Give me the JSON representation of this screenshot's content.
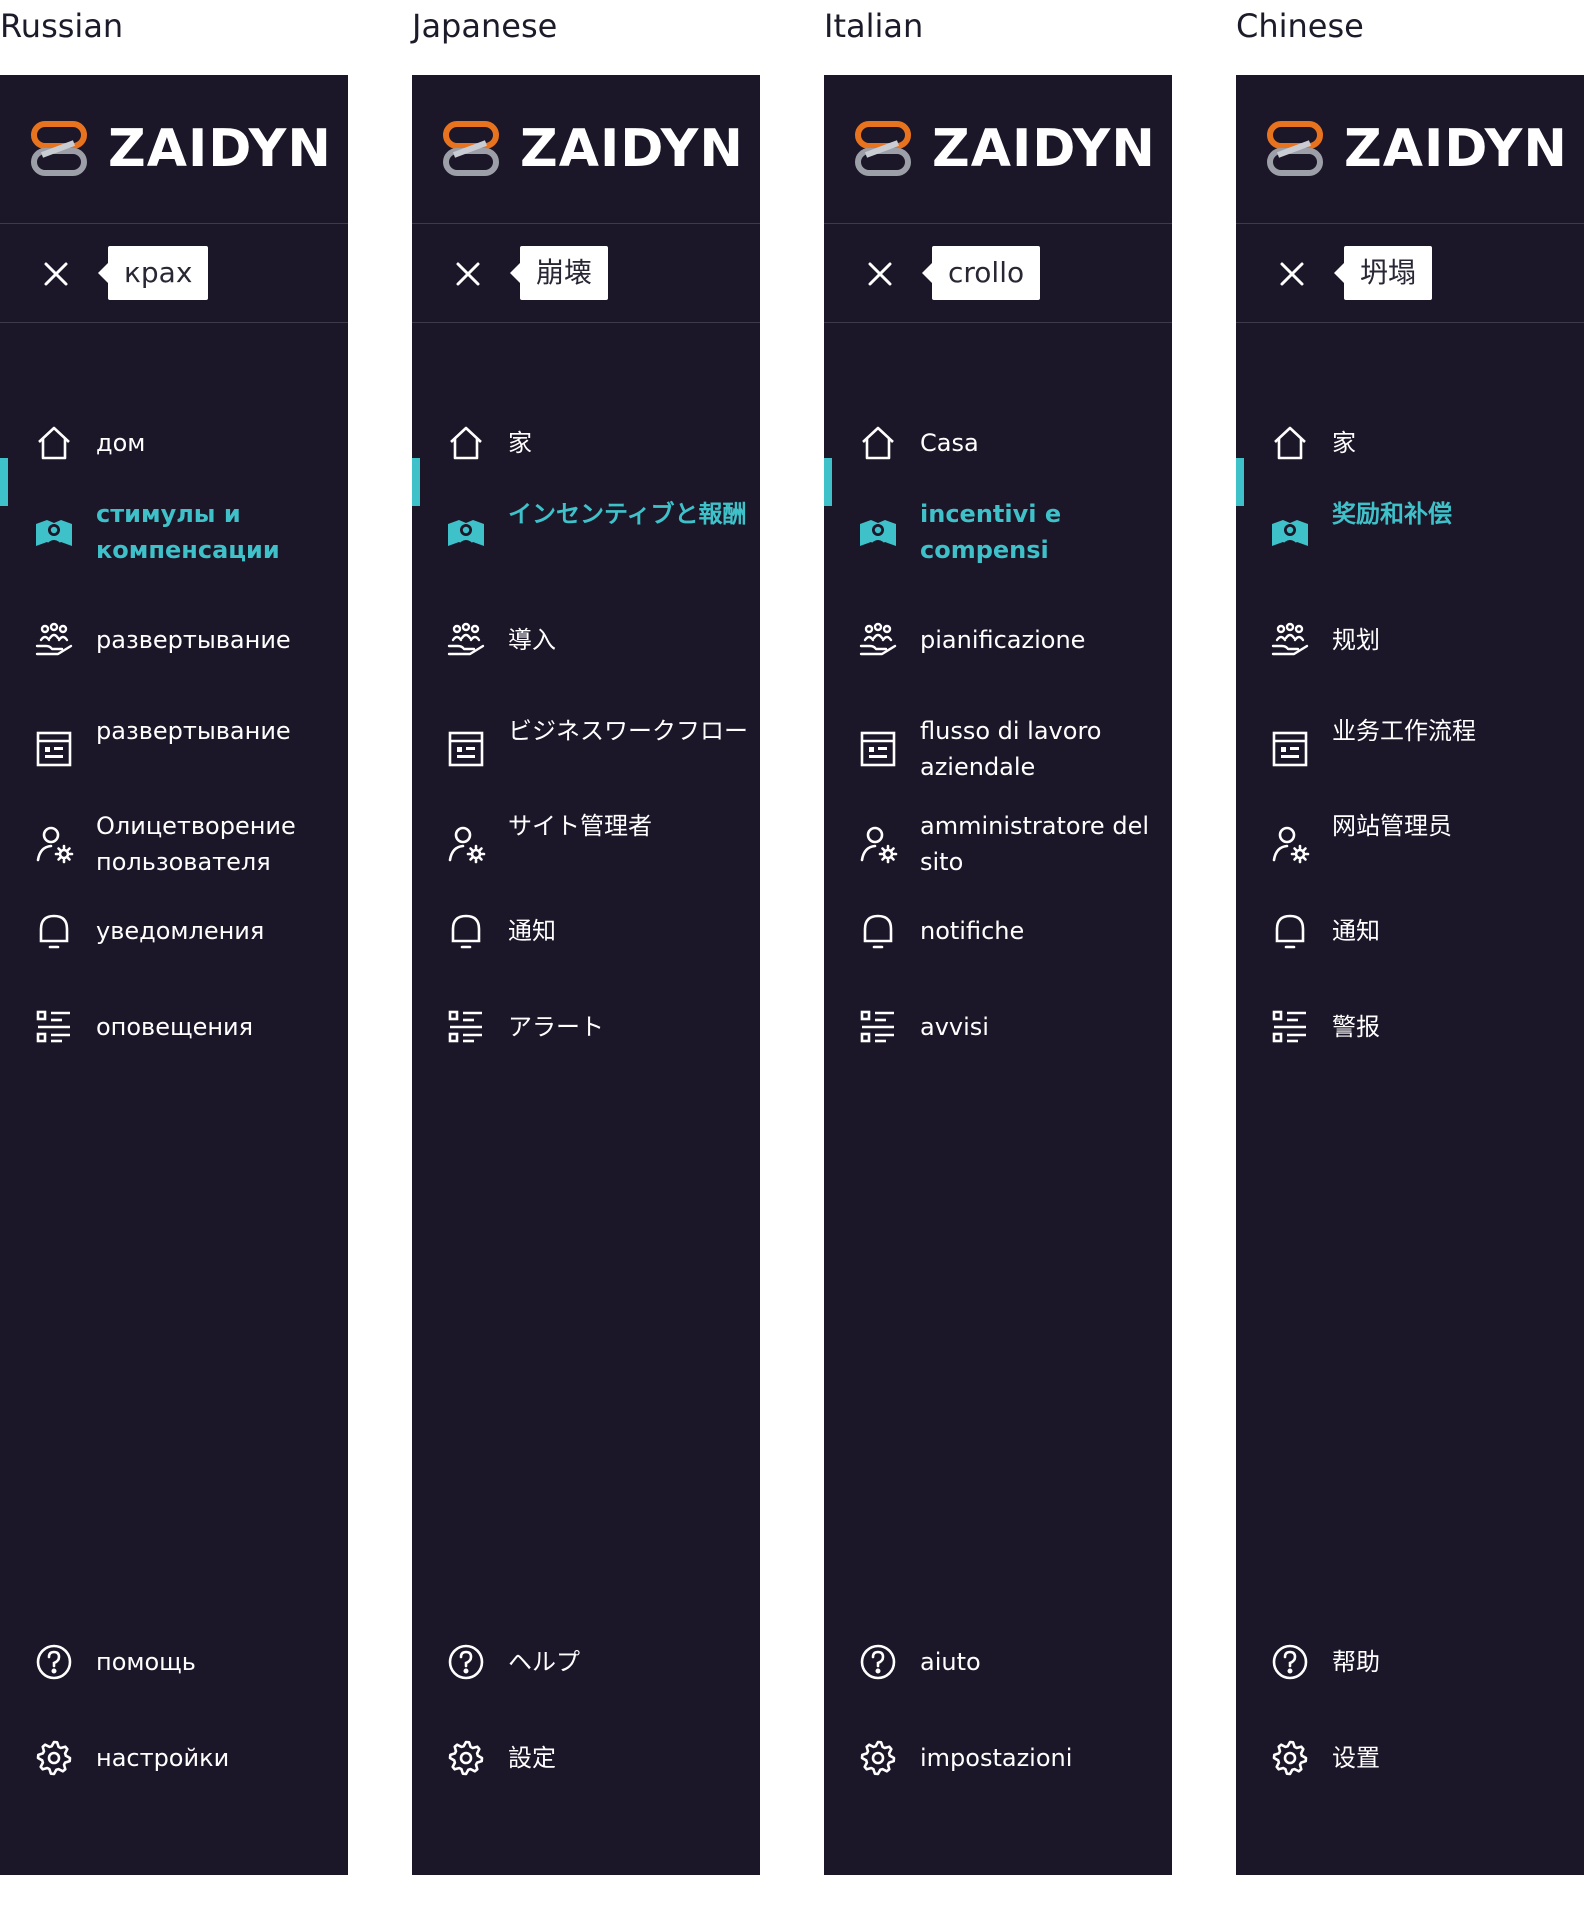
{
  "brand": {
    "name": "ZAIDYN",
    "icon": "zaidyn-logo",
    "colors": {
      "accent": "#3fc1c9",
      "orange": "#e8731f",
      "panel": "#1b1628",
      "divider": "#3e3a4c"
    }
  },
  "columns": [
    {
      "language": "Russian",
      "tooltip": "крах",
      "nav": [
        {
          "icon": "home-icon",
          "label": "дом",
          "active": false
        },
        {
          "icon": "incentive-icon",
          "label": "стимулы и компенсации",
          "active": true
        },
        {
          "icon": "hand-people-icon",
          "label": "развертывание",
          "active": false
        },
        {
          "icon": "workflow-icon",
          "label": "развертывание",
          "active": false
        },
        {
          "icon": "user-gear-icon",
          "label": "Олицетворение пользователя",
          "active": false
        },
        {
          "icon": "bell-icon",
          "label": "уведомления",
          "active": false
        },
        {
          "icon": "list-icon",
          "label": "оповещения",
          "active": false
        }
      ],
      "bottom": [
        {
          "icon": "help-icon",
          "label": "помощь"
        },
        {
          "icon": "settings-icon",
          "label": "настройки"
        }
      ]
    },
    {
      "language": "Japanese",
      "tooltip": "崩壊",
      "nav": [
        {
          "icon": "home-icon",
          "label": "家",
          "active": false
        },
        {
          "icon": "incentive-icon",
          "label": "インセンティブと報酬",
          "active": true
        },
        {
          "icon": "hand-people-icon",
          "label": "導入",
          "active": false
        },
        {
          "icon": "workflow-icon",
          "label": "ビジネスワークフロー",
          "active": false
        },
        {
          "icon": "user-gear-icon",
          "label": "サイト管理者",
          "active": false
        },
        {
          "icon": "bell-icon",
          "label": "通知",
          "active": false
        },
        {
          "icon": "list-icon",
          "label": "アラート",
          "active": false
        }
      ],
      "bottom": [
        {
          "icon": "help-icon",
          "label": "ヘルプ"
        },
        {
          "icon": "settings-icon",
          "label": "設定"
        }
      ]
    },
    {
      "language": "Italian",
      "tooltip": "crollo",
      "nav": [
        {
          "icon": "home-icon",
          "label": "Casa",
          "active": false
        },
        {
          "icon": "incentive-icon",
          "label": "incentivi e compensi",
          "active": true
        },
        {
          "icon": "hand-people-icon",
          "label": "pianificazione",
          "active": false
        },
        {
          "icon": "workflow-icon",
          "label": "flusso di lavoro aziendale",
          "active": false
        },
        {
          "icon": "user-gear-icon",
          "label": "amministratore del sito",
          "active": false
        },
        {
          "icon": "bell-icon",
          "label": "notifiche",
          "active": false
        },
        {
          "icon": "list-icon",
          "label": "avvisi",
          "active": false
        }
      ],
      "bottom": [
        {
          "icon": "help-icon",
          "label": "aiuto"
        },
        {
          "icon": "settings-icon",
          "label": "impostazioni"
        }
      ]
    },
    {
      "language": "Chinese",
      "tooltip": "坍塌",
      "nav": [
        {
          "icon": "home-icon",
          "label": "家",
          "active": false
        },
        {
          "icon": "incentive-icon",
          "label": "奖励和补偿",
          "active": true
        },
        {
          "icon": "hand-people-icon",
          "label": "规划",
          "active": false
        },
        {
          "icon": "workflow-icon",
          "label": "业务工作流程",
          "active": false
        },
        {
          "icon": "user-gear-icon",
          "label": "网站管理员",
          "active": false
        },
        {
          "icon": "bell-icon",
          "label": "通知",
          "active": false
        },
        {
          "icon": "list-icon",
          "label": "警报",
          "active": false
        }
      ],
      "bottom": [
        {
          "icon": "help-icon",
          "label": "帮助"
        },
        {
          "icon": "settings-icon",
          "label": "设置"
        }
      ]
    }
  ]
}
